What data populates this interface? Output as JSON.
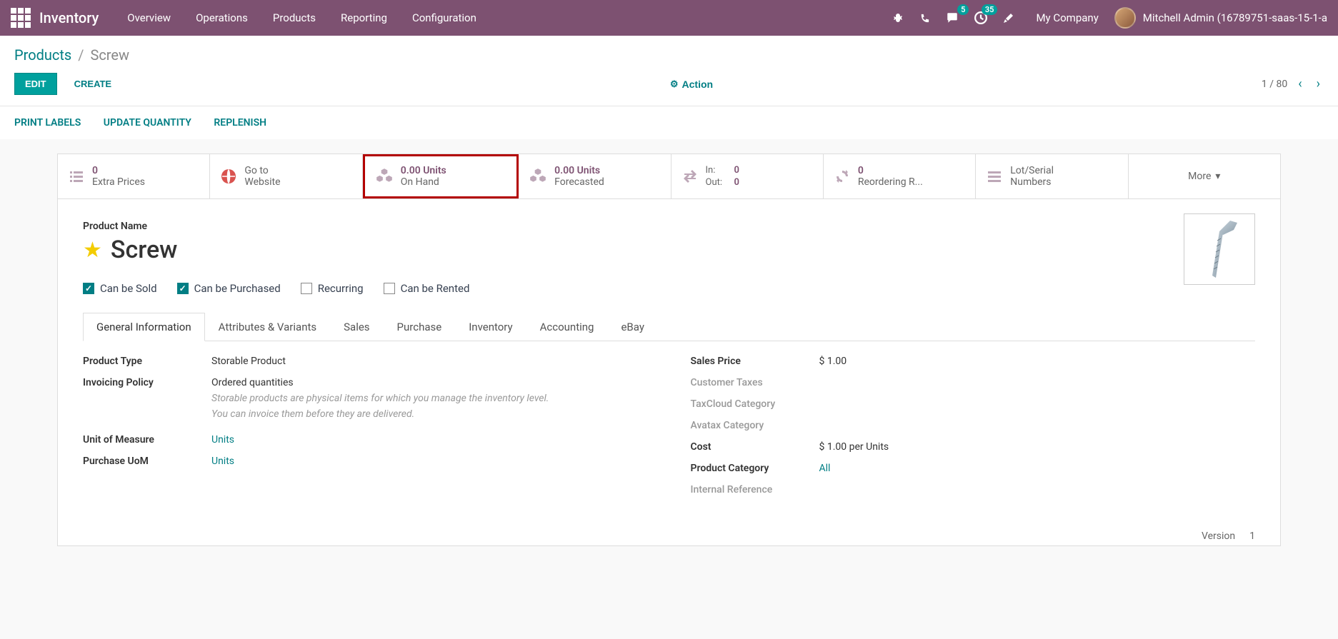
{
  "topbar": {
    "app_title": "Inventory",
    "nav": [
      "Overview",
      "Operations",
      "Products",
      "Reporting",
      "Configuration"
    ],
    "messages_badge": "5",
    "activities_badge": "35",
    "company": "My Company",
    "user": "Mitchell Admin (16789751-saas-15-1-a"
  },
  "breadcrumbs": {
    "parent": "Products",
    "current": "Screw"
  },
  "control": {
    "edit": "EDIT",
    "create": "CREATE",
    "action": "Action",
    "pager": "1 / 80"
  },
  "actions": [
    "PRINT LABELS",
    "UPDATE QUANTITY",
    "REPLENISH"
  ],
  "stats": {
    "extra_prices": {
      "val": "0",
      "lbl": "Extra Prices"
    },
    "website": {
      "val": "Go to",
      "lbl": "Website"
    },
    "onhand": {
      "val": "0.00 Units",
      "lbl": "On Hand"
    },
    "forecast": {
      "val": "0.00 Units",
      "lbl": "Forecasted"
    },
    "inout": {
      "in_lbl": "In:",
      "in_val": "0",
      "out_lbl": "Out:",
      "out_val": "0"
    },
    "reorder": {
      "val": "0",
      "lbl": "Reordering R..."
    },
    "lots": {
      "val": "Lot/Serial",
      "lbl": "Numbers"
    },
    "more": "More"
  },
  "product": {
    "name_label": "Product Name",
    "name": "Screw",
    "checks": {
      "sold": "Can be Sold",
      "purchased": "Can be Purchased",
      "recurring": "Recurring",
      "rented": "Can be Rented"
    }
  },
  "tabs": [
    "General Information",
    "Attributes & Variants",
    "Sales",
    "Purchase",
    "Inventory",
    "Accounting",
    "eBay"
  ],
  "form": {
    "left": {
      "type_lbl": "Product Type",
      "type_val": "Storable Product",
      "invpol_lbl": "Invoicing Policy",
      "invpol_val": "Ordered quantities",
      "note1": "Storable products are physical items for which you manage the inventory level.",
      "note2": "You can invoice them before they are delivered.",
      "uom_lbl": "Unit of Measure",
      "uom_val": "Units",
      "puom_lbl": "Purchase UoM",
      "puom_val": "Units"
    },
    "right": {
      "price_lbl": "Sales Price",
      "price_val": "$ 1.00",
      "ctax_lbl": "Customer Taxes",
      "tcloud_lbl": "TaxCloud Category",
      "avatax_lbl": "Avatax Category",
      "cost_lbl": "Cost",
      "cost_val": "$ 1.00 per Units",
      "cat_lbl": "Product Category",
      "cat_val": "All",
      "ref_lbl": "Internal Reference"
    }
  },
  "version": {
    "lbl": "Version",
    "val": "1"
  }
}
